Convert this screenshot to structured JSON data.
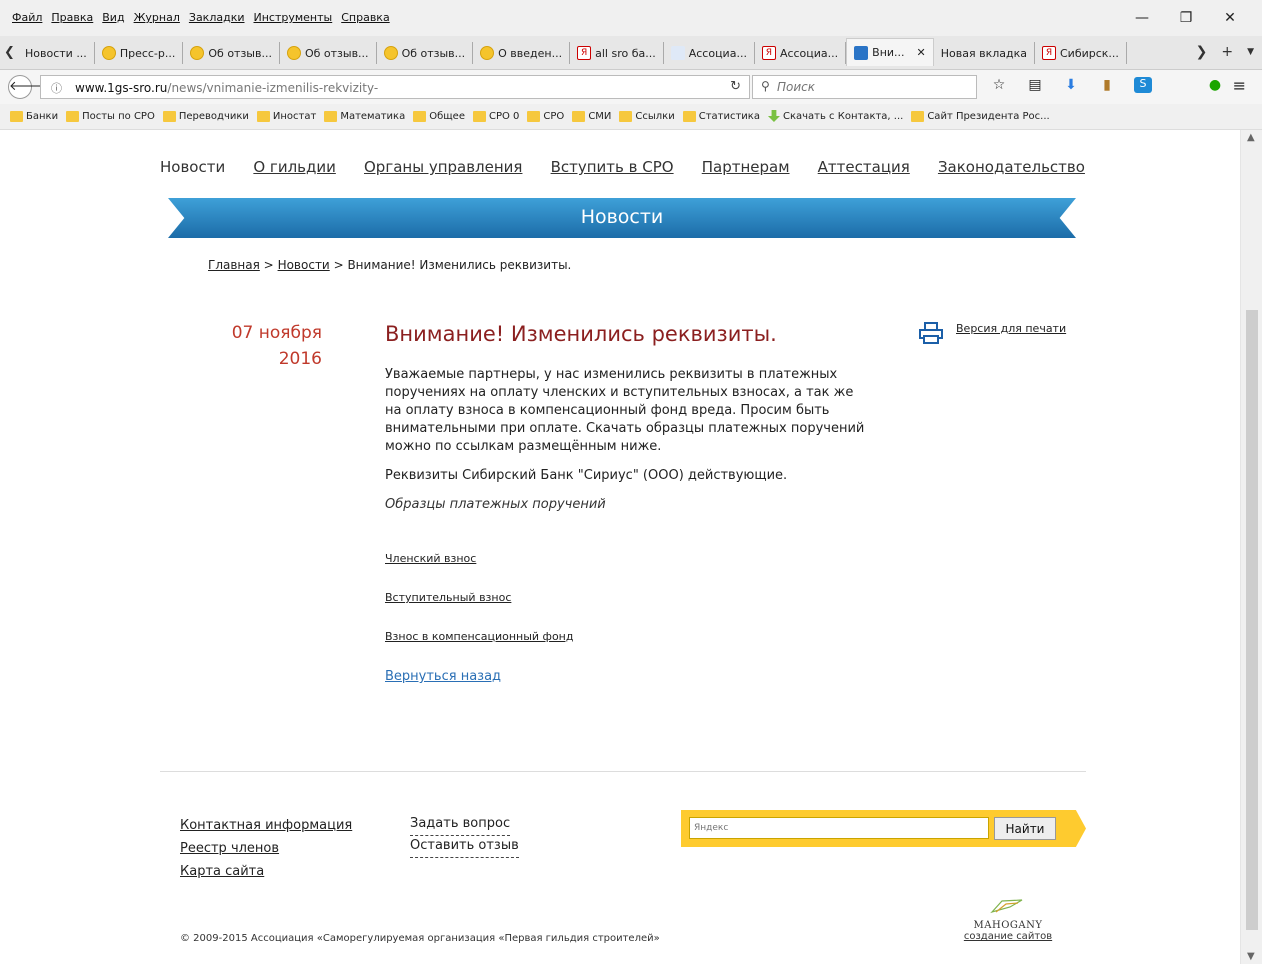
{
  "browser": {
    "menu": [
      "Файл",
      "Правка",
      "Вид",
      "Журнал",
      "Закладки",
      "Инструменты",
      "Справка"
    ],
    "window_controls": {
      "minimize": "—",
      "restore": "❐",
      "close": "✕"
    },
    "tabs": [
      {
        "label": "Новости ...",
        "icon": "none"
      },
      {
        "label": "Пресс-р...",
        "icon": "smile"
      },
      {
        "label": "Об отзыв...",
        "icon": "smile"
      },
      {
        "label": "Об отзыв...",
        "icon": "smile"
      },
      {
        "label": "Об отзыв...",
        "icon": "smile"
      },
      {
        "label": "О введен...",
        "icon": "smile"
      },
      {
        "label": "all sro ба...",
        "icon": "ya"
      },
      {
        "label": "Ассоциа...",
        "icon": "feather"
      },
      {
        "label": "Ассоциа...",
        "icon": "ya"
      },
      {
        "label": "Вни...",
        "icon": "one",
        "active": true
      },
      {
        "label": "Новая вкладка",
        "icon": "none"
      },
      {
        "label": "Сибирск...",
        "icon": "ya"
      }
    ],
    "tab_close": "✕",
    "url_domain": "www.1gs-sro.ru",
    "url_path": "/news/vnimanie-izmenilis-rekvizity-",
    "search_placeholder": "Поиск",
    "bookmarks": [
      {
        "label": "Банки",
        "type": "folder"
      },
      {
        "label": "Посты по СРО",
        "type": "folder"
      },
      {
        "label": "Переводчики",
        "type": "folder"
      },
      {
        "label": "Иностат",
        "type": "folder"
      },
      {
        "label": "Математика",
        "type": "folder"
      },
      {
        "label": "Общее",
        "type": "folder"
      },
      {
        "label": "СРО 0",
        "type": "folder"
      },
      {
        "label": "СРО",
        "type": "folder"
      },
      {
        "label": "СМИ",
        "type": "folder"
      },
      {
        "label": "Ссылки",
        "type": "folder"
      },
      {
        "label": "Статистика",
        "type": "folder"
      },
      {
        "label": "Скачать с Контакта, ...",
        "type": "download"
      },
      {
        "label": "Сайт Президента Рос...",
        "type": "folder"
      }
    ]
  },
  "page": {
    "nav": [
      "Новости",
      "О гильдии",
      "Органы управления",
      "Вступить в СРО",
      "Партнерам",
      "Аттестация",
      "Законодательство"
    ],
    "banner_title": "Новости",
    "breadcrumb": {
      "home": "Главная",
      "sep": ">",
      "section": "Новости",
      "current": "Внимание! Изменились реквизиты."
    },
    "date": {
      "day_month": "07 ноября",
      "year": "2016"
    },
    "article": {
      "title": "Внимание! Изменились реквизиты.",
      "p1": "Уважаемые партнеры, у нас изменились реквизиты в платежных поручениях на оплату членских и вступительных взносах, а так же на оплату взноса в компенсационный фонд вреда. Просим быть внимательными при оплате. Скачать образцы платежных поручений можно по ссылкам размещённым ниже.",
      "p2": "Реквизиты Сибирский Банк \"Сириус\" (ООО) действующие.",
      "p3": "Образцы платежных поручений",
      "links": [
        "Членский взнос",
        "Вступительный взнос",
        "Взнос в компенсационный фонд"
      ],
      "back": "Вернуться назад"
    },
    "print_label": "Версия для печати",
    "footer": {
      "col1": [
        "Контактная информация",
        "Реестр членов",
        "Карта сайта"
      ],
      "col2": [
        "Задать вопрос",
        "Оставить отзыв"
      ],
      "yandex_placeholder": "Яндекс",
      "yandex_button": "Найти",
      "logo_brand": "MAHOGANY",
      "logo_link": "создание сайтов",
      "copyright": "© 2009-2015 Ассоциация «Саморегулируемая организация «Первая гильдия строителей»"
    }
  },
  "colors": {
    "banner": "#2a86c7",
    "date": "#c0392b",
    "title": "#8b1f1f",
    "link_back": "#2a6fb5",
    "yandex": "#fecb2f"
  }
}
